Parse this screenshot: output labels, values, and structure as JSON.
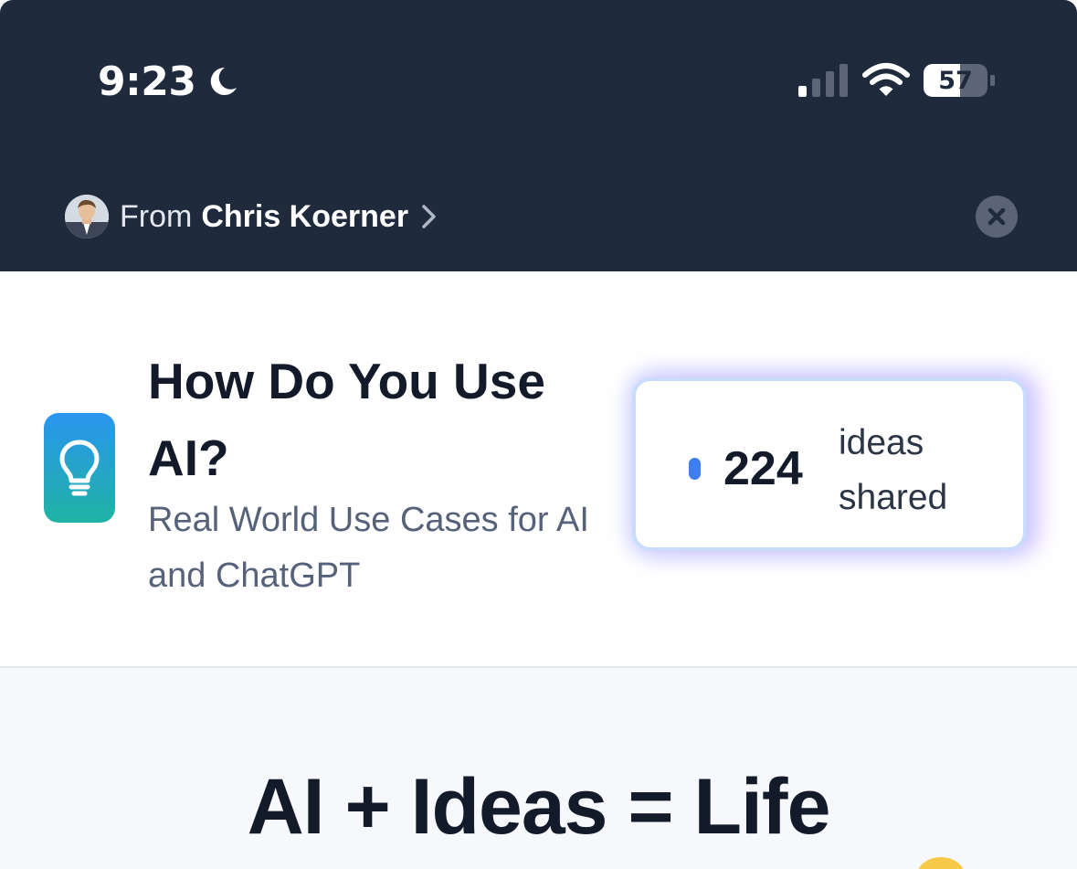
{
  "status_bar": {
    "time": "9:23",
    "battery_level": "57",
    "icons": [
      "moon-icon",
      "cellular-signal-icon",
      "wifi-icon",
      "battery-icon"
    ]
  },
  "from_bar": {
    "label": "From",
    "author": "Chris Koerner",
    "icons": [
      "avatar",
      "chevron-right-icon",
      "close-icon"
    ]
  },
  "app": {
    "title": "How Do You Use AI?",
    "subtitle": "Real World Use Cases for AI and ChatGPT",
    "icon": "lightbulb-icon",
    "accent_gradient": [
      "#2a95ee",
      "#1fb3a4"
    ]
  },
  "ideas": {
    "count": "224",
    "label": "ideas shared",
    "dot_color": "#3f7ef0"
  },
  "hero": {
    "title": "AI + Ideas = Life"
  },
  "colors": {
    "header_bg": "#1f2a3d",
    "card_bg": "#ffffff",
    "page_bg": "#f7f8fb",
    "text_dark": "#131b2b"
  }
}
